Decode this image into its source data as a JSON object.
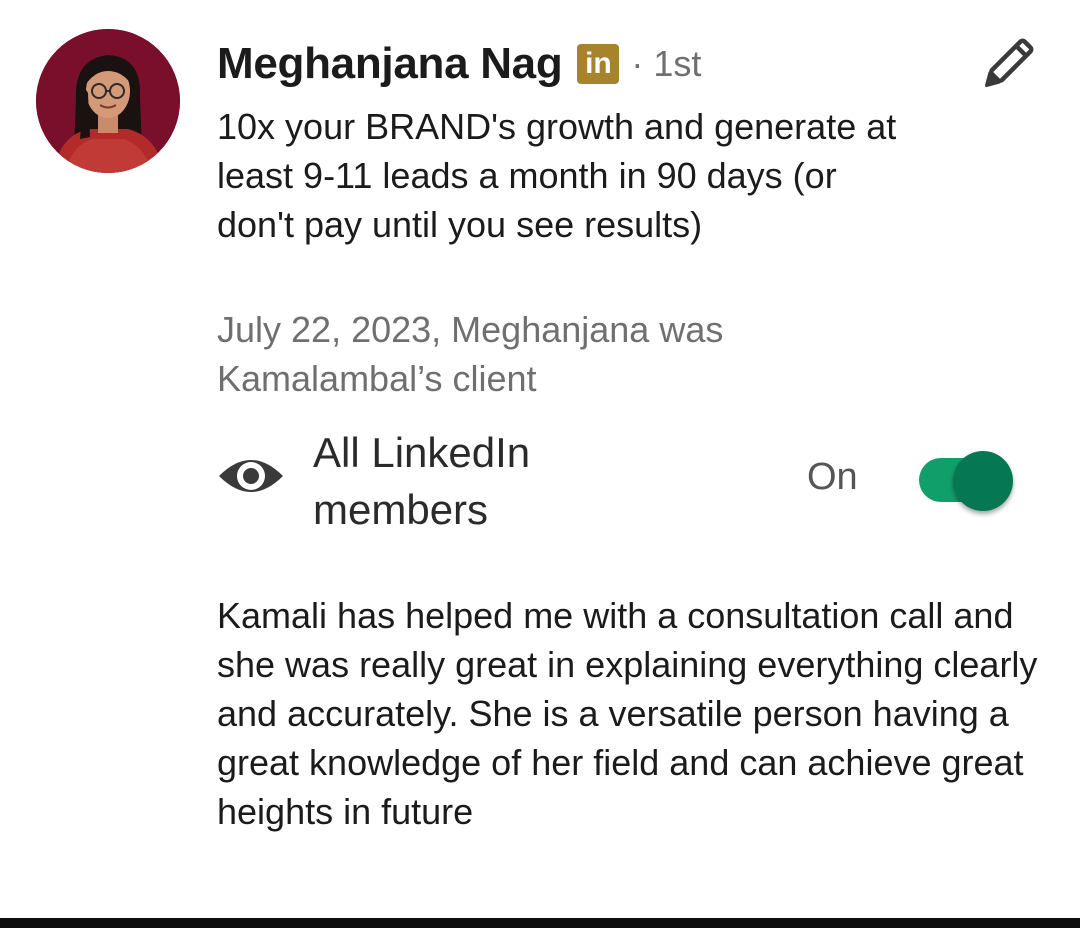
{
  "recommender": {
    "name": "Meghanjana Nag",
    "badge": "in",
    "degree": "· 1st",
    "headline": "10x your BRAND's growth and generate at least 9-11 leads a month in 90 days (or don't pay until you see results)",
    "relationship": "July 22, 2023, Meghanjana was Kamalambal’s client"
  },
  "visibility": {
    "label": "All LinkedIn members",
    "state_label": "On",
    "enabled": true
  },
  "recommendation_text": "Kamali has helped me with a consultation call and she was really great in explaining everything clearly and accurately. She is a versatile person having a great knowledge of her field and can achieve great heights in future",
  "icons": {
    "edit": "pencil-icon",
    "visibility": "eye-icon"
  },
  "colors": {
    "avatar_bg": "#7a0f2c",
    "linkedin_badge": "#a8832e",
    "toggle_track": "#109f6a",
    "toggle_thumb": "#067753",
    "secondary_text": "#6f6f6f"
  }
}
